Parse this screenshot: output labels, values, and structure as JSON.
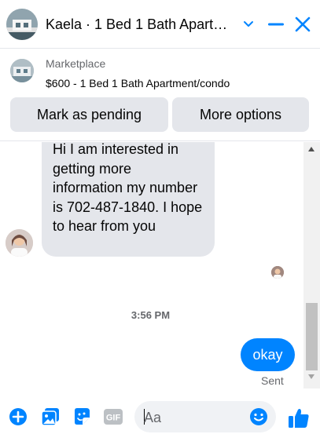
{
  "header": {
    "title": "Kaela · 1 Bed 1 Bath Apart…",
    "icons": {
      "avatar": "profile-photo",
      "chevron": "chevron-down-icon",
      "minimize": "minimize-icon",
      "close": "close-icon"
    }
  },
  "marketplace": {
    "label": "Marketplace",
    "listing": "$600 - 1 Bed 1 Bath Apartment/condo",
    "buttons": {
      "pending": "Mark as pending",
      "more": "More options"
    }
  },
  "messages": {
    "incoming_text": "Hi I am interested in getting more information my number is 702-487-1840. I hope to hear from you",
    "timestamp": "3:56 PM",
    "outgoing_text": "okay",
    "status": "Sent"
  },
  "composer": {
    "placeholder": "Aa",
    "icons": [
      "plus-circle-icon",
      "photo-icon",
      "sticker-icon",
      "gif-icon",
      "emoji-icon",
      "thumbs-up-icon"
    ],
    "gif_label": "GIF"
  },
  "colors": {
    "accent": "#0084ff",
    "bubble_in": "#e4e6eb",
    "muted_text": "#65676b"
  }
}
